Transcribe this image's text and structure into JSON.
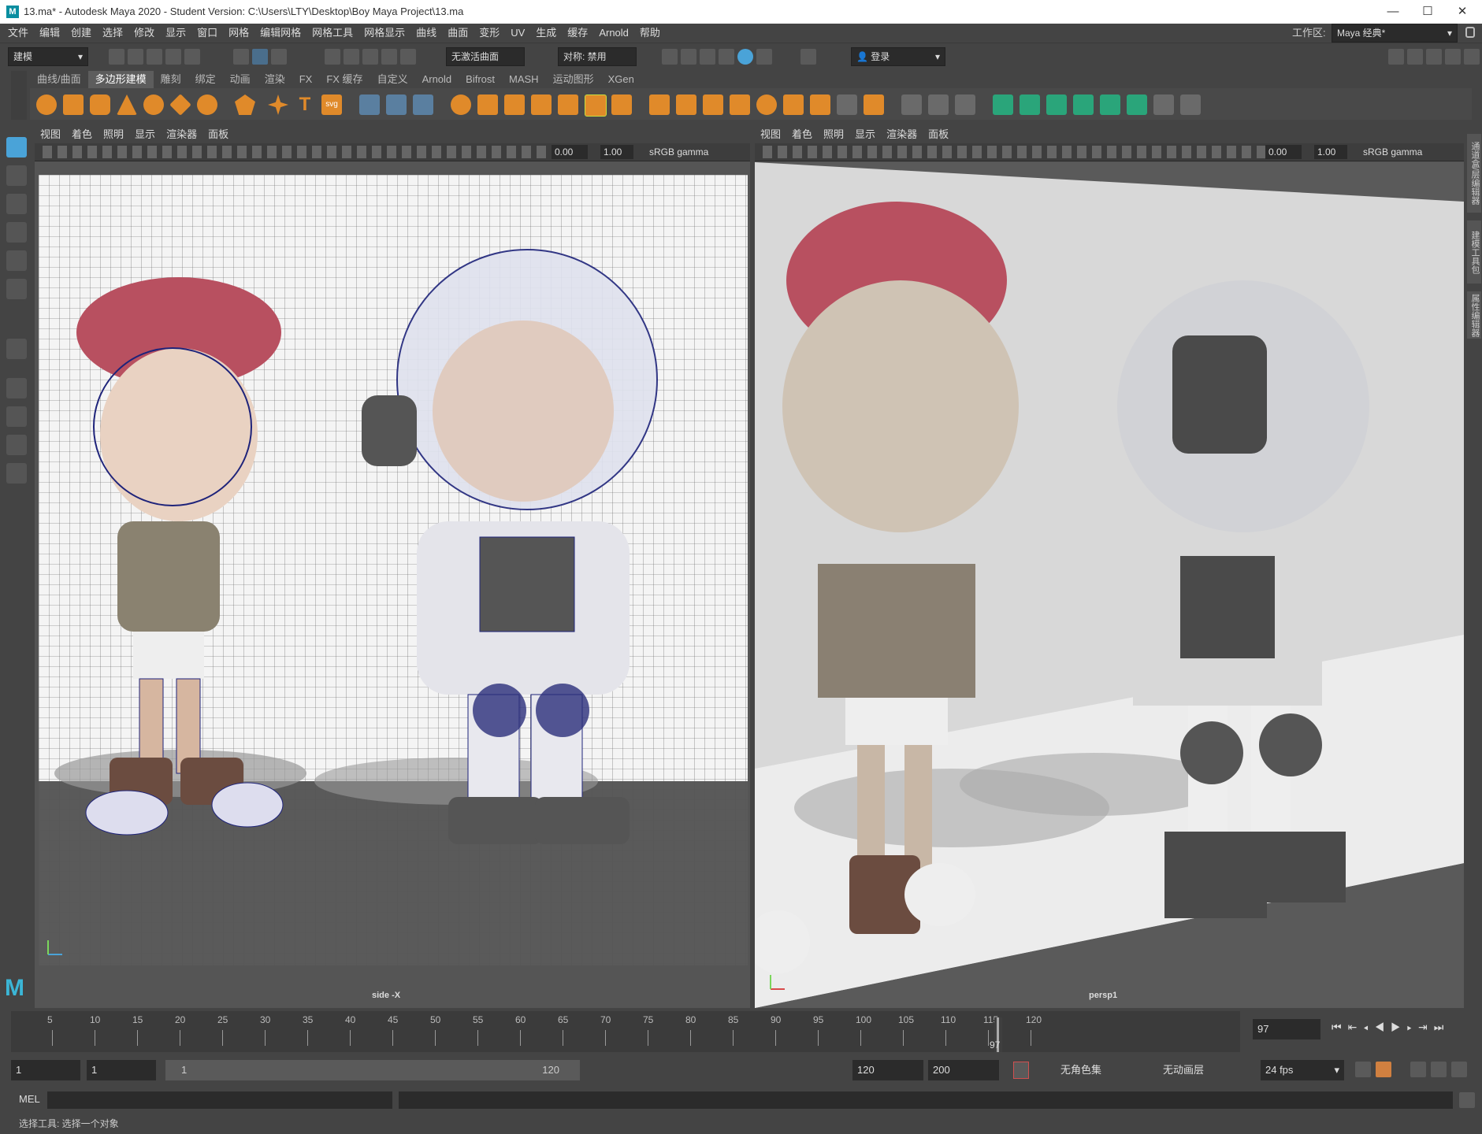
{
  "window": {
    "title": "13.ma* - Autodesk Maya 2020 - Student Version: C:\\Users\\LTY\\Desktop\\Boy Maya Project\\13.ma",
    "logo": "M"
  },
  "menus": [
    "文件",
    "编辑",
    "创建",
    "选择",
    "修改",
    "显示",
    "窗口",
    "网格",
    "编辑网格",
    "网格工具",
    "网格显示",
    "曲线",
    "曲面",
    "变形",
    "UV",
    "生成",
    "缓存",
    "Arnold",
    "帮助"
  ],
  "workspace": {
    "label": "工作区:",
    "value": "Maya 经典*"
  },
  "status": {
    "menuset": "建模",
    "live_surface": "无激活曲面",
    "symmetry": "对称: 禁用",
    "login": "登录"
  },
  "shelf_tabs": [
    "曲线/曲面",
    "多边形建模",
    "雕刻",
    "绑定",
    "动画",
    "渲染",
    "FX",
    "FX 缓存",
    "自定义",
    "Arnold",
    "Bifrost",
    "MASH",
    "运动图形",
    "XGen"
  ],
  "shelf_active": 1,
  "viewport_left": {
    "menus": [
      "视图",
      "着色",
      "照明",
      "显示",
      "渲染器",
      "面板"
    ],
    "exposure": "0.00",
    "gamma": "1.00",
    "colorspace": "sRGB gamma",
    "camera": "side -X"
  },
  "viewport_right": {
    "menus": [
      "视图",
      "着色",
      "照明",
      "显示",
      "渲染器",
      "面板"
    ],
    "exposure": "0.00",
    "gamma": "1.00",
    "colorspace": "sRGB gamma",
    "camera": "persp1"
  },
  "timeline": {
    "ticks": [
      "5",
      "10",
      "15",
      "20",
      "25",
      "30",
      "35",
      "40",
      "45",
      "50",
      "55",
      "60",
      "65",
      "70",
      "75",
      "80",
      "85",
      "90",
      "95",
      "100",
      "105",
      "110",
      "115",
      "120"
    ],
    "current": "97",
    "current_field": "97"
  },
  "range": {
    "start": "1",
    "playback_start": "1",
    "slider_start": "1",
    "slider_end": "120",
    "playback_end": "120",
    "end": "200",
    "character_set": "无角色集",
    "anim_layer": "无动画层",
    "fps": "24 fps"
  },
  "command": {
    "label": "MEL"
  },
  "help_line": "选择工具: 选择一个对象",
  "right_tabs": [
    "通道盒/层编辑器",
    "建模工具包",
    "属性编辑器"
  ],
  "colors": {
    "accent": "#4aa3d8",
    "ui_bg": "#444444",
    "viewport_grid_bg": "#f2f2f2"
  }
}
